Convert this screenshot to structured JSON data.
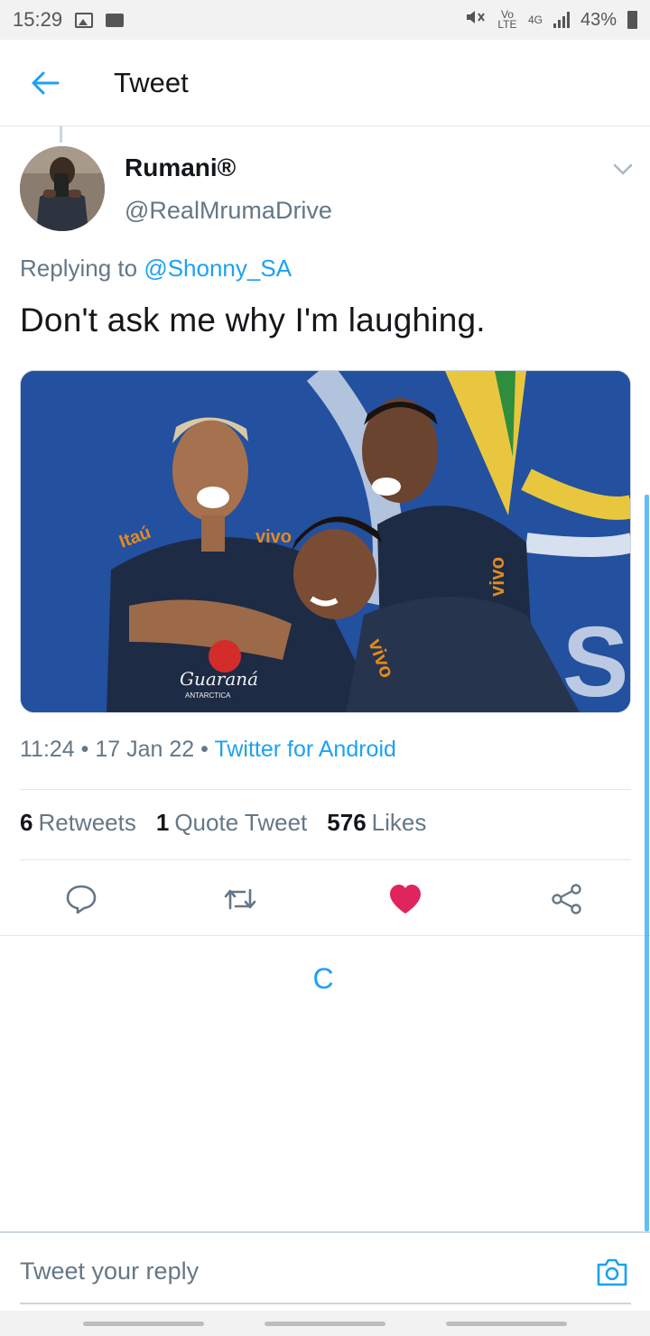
{
  "status_bar": {
    "time": "15:29",
    "network": "4G",
    "volte": "Vo LTE",
    "battery": "43%"
  },
  "header": {
    "title": "Tweet"
  },
  "tweet": {
    "user_name": "Rumani®",
    "user_handle": "@RealMrumaDrive",
    "replying_prefix": "Replying to",
    "replying_to": "@Shonny_SA",
    "text": "Don't ask me why I'm laughing.",
    "media": {
      "jersey_brand_1": "Itaú",
      "jersey_brand_2": "vivo",
      "sponsor": "Guaraná",
      "sponsor_sub": "ANTARCTICA"
    },
    "time": "11:24",
    "date": "17 Jan 22",
    "source": "Twitter for Android",
    "sep": "•"
  },
  "stats": {
    "retweets_count": "6",
    "retweets_label": "Retweets",
    "quotes_count": "1",
    "quotes_label": "Quote Tweet",
    "likes_count": "576",
    "likes_label": "Likes"
  },
  "actions": {
    "reply": "reply-icon",
    "retweet": "retweet-icon",
    "like": "heart-icon",
    "share": "share-icon",
    "liked": true,
    "like_color": "#e0245e",
    "accent": "#1da1f2"
  },
  "loading": {
    "glyph": "C"
  },
  "composer": {
    "placeholder": "Tweet your reply"
  }
}
